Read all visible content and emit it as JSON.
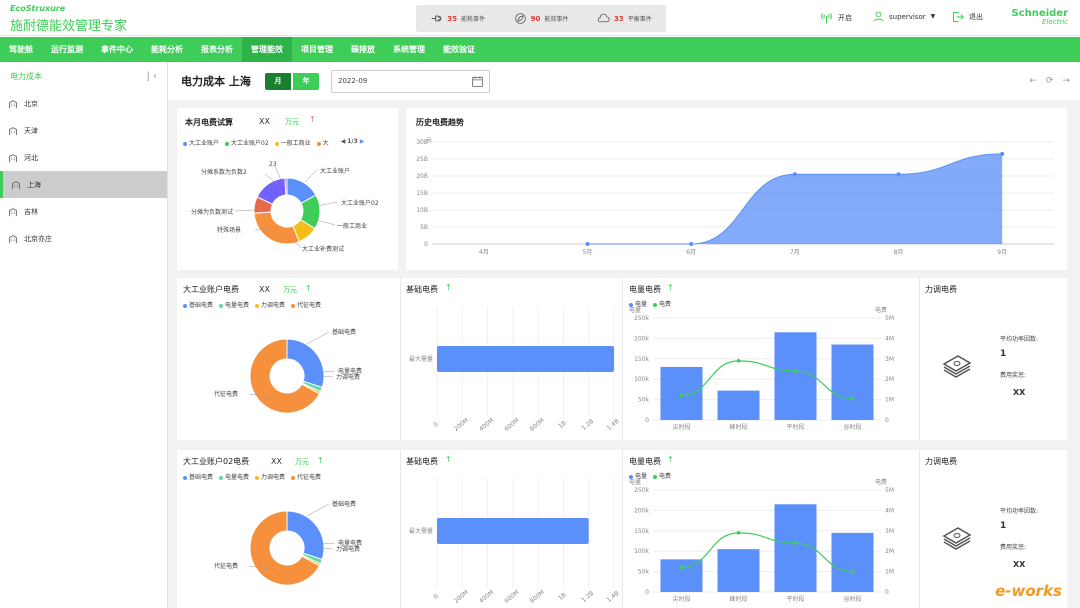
{
  "header": {
    "logo_small": "EcoStruxure",
    "title": "施耐德能效管理专家",
    "events": [
      {
        "count": "35",
        "label": "能耗事件"
      },
      {
        "count": "90",
        "label": "能效事件"
      },
      {
        "count": "33",
        "label": "平衡事件"
      }
    ],
    "open_label": "开启",
    "user": "supervisor",
    "logout_label": "退出",
    "brand_line1": "Schneider",
    "brand_line2": "Electric"
  },
  "nav": [
    "驾驶舱",
    "运行监测",
    "事件中心",
    "能耗分析",
    "报表分析",
    "管理能效",
    "项目管理",
    "碳排放",
    "系统管理",
    "能效验证"
  ],
  "nav_active": 5,
  "sidebar": {
    "title": "电力成本",
    "items": [
      "北京",
      "天津",
      "河北",
      "上海",
      "吉林",
      "北京亦庄"
    ],
    "active": 3
  },
  "toolbar": {
    "title": "电力成本 上海",
    "month_label": "月",
    "year_label": "年",
    "date_value": "2022-09"
  },
  "monthly": {
    "title": "本月电费试算",
    "value": "XX",
    "unit": "万元",
    "legend": [
      "大工业账户",
      "大工业账户02",
      "一般工商业",
      "大"
    ],
    "pager": "1/3",
    "top_value": "23",
    "labels": [
      "分摊系数为负数2",
      "大工业账户",
      "大工业账户02",
      "一般工商业",
      "分摊为负数测试",
      "特殊场景",
      "大工业补费测试"
    ]
  },
  "history": {
    "title": "历史电费趋势",
    "unit": "元"
  },
  "account1": {
    "title": "大工业账户电费",
    "value": "XX",
    "unit": "万元"
  },
  "account2": {
    "title": "大工业账户02电费",
    "value": "XX",
    "unit": "万元"
  },
  "donut_legend": [
    "基础电费",
    "电量电费",
    "力调电费",
    "代征电费"
  ],
  "donut_labels": {
    "a": "基础电费",
    "b": "电量电费",
    "c": "力调电费",
    "d": "代征电费"
  },
  "basic_title": "基础电费",
  "basic_category": "最大需量",
  "basic_axis": [
    "0",
    "200M",
    "400M",
    "600M",
    "800M",
    "1B",
    "1.2B",
    "1.4B"
  ],
  "energy_title": "电量电费",
  "energy_legend": [
    "电量",
    "电费"
  ],
  "energy_ylabel_left": "电量",
  "energy_ylabel_right": "电费",
  "power_title": "力调电费",
  "power_factor_label": "平均功率因数:",
  "power_factor_value": "1",
  "power_reward_label": "费用奖惩:",
  "power_reward_value": "XX",
  "watermark": "e-works",
  "colors": {
    "green": "#3dcd58",
    "blue": "#5b8ff9",
    "orange": "#f6903d",
    "purple": "#7262fd",
    "lightgreen": "#5ad8a6"
  },
  "chart_data": [
    {
      "type": "pie",
      "title": "本月电费试算",
      "categories": [
        "大工业账户",
        "大工业账户02",
        "一般工商业",
        "大工业补费测试",
        "特殊场景",
        "分摊为负数测试",
        "分摊系数为负数2"
      ],
      "values": [
        17,
        17,
        10,
        30,
        8,
        17,
        1
      ]
    },
    {
      "type": "area",
      "title": "历史电费趋势",
      "ylabel": "元",
      "x": [
        "4月",
        "5月",
        "6月",
        "7月",
        "8月",
        "9月"
      ],
      "values": [
        null,
        0,
        0,
        205,
        205,
        265
      ],
      "ylim": [
        0,
        300
      ],
      "yticks": [
        "0",
        "5B",
        "10B",
        "15B",
        "20B",
        "25B",
        "30B"
      ]
    },
    {
      "type": "pie",
      "title": "大工业账户电费",
      "categories": [
        "基础电费",
        "电量电费",
        "力调电费",
        "代征电费"
      ],
      "values": [
        30,
        2,
        1,
        67
      ]
    },
    {
      "type": "bar",
      "title": "基础电费",
      "categories": [
        "最大需量"
      ],
      "values": [
        1.4
      ],
      "xlabel": "",
      "xlim": [
        0,
        1.4
      ]
    },
    {
      "type": "bar",
      "title": "电量电费",
      "categories": [
        "尖时段",
        "峰时段",
        "平时段",
        "谷时段"
      ],
      "series": [
        {
          "name": "电量",
          "values": [
            130000,
            72000,
            215000,
            185000
          ]
        },
        {
          "name": "电费",
          "values": [
            1200000,
            2900000,
            2400000,
            1050000
          ]
        }
      ],
      "yticks_left": [
        "0",
        "50k",
        "100k",
        "150k",
        "200k",
        "250k"
      ],
      "yticks_right": [
        "0",
        "1M",
        "2M",
        "3M",
        "4M",
        "5M"
      ]
    },
    {
      "type": "pie",
      "title": "大工业账户02电费",
      "categories": [
        "基础电费",
        "电量电费",
        "力调电费",
        "代征电费"
      ],
      "values": [
        30,
        2,
        1,
        67
      ]
    },
    {
      "type": "bar",
      "title": "基础电费",
      "categories": [
        "最大需量"
      ],
      "values": [
        1.2
      ],
      "xlim": [
        0,
        1.4
      ]
    },
    {
      "type": "bar",
      "title": "电量电费",
      "categories": [
        "尖时段",
        "峰时段",
        "平时段",
        "谷时段"
      ],
      "series": [
        {
          "name": "电量",
          "values": [
            80000,
            105000,
            215000,
            145000
          ]
        },
        {
          "name": "电费",
          "values": [
            1200000,
            2900000,
            2400000,
            1000000
          ]
        }
      ],
      "yticks_left": [
        "0",
        "50k",
        "100k",
        "150k",
        "200k",
        "250k"
      ],
      "yticks_right": [
        "0",
        "1M",
        "2M",
        "3M",
        "4M",
        "5M"
      ]
    }
  ]
}
